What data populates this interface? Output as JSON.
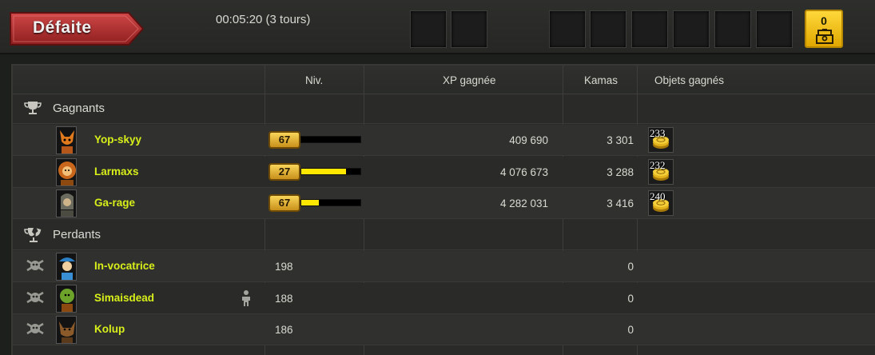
{
  "header": {
    "result": "Défaite",
    "duration": "00:05:20 (3 tours)",
    "chest_count": "0",
    "chest_icon": "loot-chest-icon",
    "accent_color": "#f5c518"
  },
  "columns": {
    "level": "Niv.",
    "xp": "XP gagnée",
    "kamas": "Kamas",
    "items": "Objets gagnés"
  },
  "sections": {
    "winners": "Gagnants",
    "losers": "Perdants"
  },
  "winners": [
    {
      "name": "Yop-skyy",
      "level": "67",
      "level_progress": 0.0,
      "xp": "409 690",
      "kamas": "3 301",
      "item_count": "233",
      "item_icon": "kamas-coin-icon"
    },
    {
      "name": "Larmaxs",
      "level": "27",
      "level_progress": 0.76,
      "xp": "4 076 673",
      "kamas": "3 288",
      "item_count": "232",
      "item_icon": "kamas-coin-icon"
    },
    {
      "name": "Ga-rage",
      "level": "67",
      "level_progress": 0.3,
      "xp": "4 282 031",
      "kamas": "3 416",
      "item_count": "240",
      "item_icon": "kamas-coin-icon"
    }
  ],
  "losers": [
    {
      "name": "In-vocatrice",
      "level": "198",
      "kamas": "0"
    },
    {
      "name": "Simaisdead",
      "level": "188",
      "kamas": "0",
      "spectator": true
    },
    {
      "name": "Kolup",
      "level": "186",
      "kamas": "0"
    }
  ]
}
